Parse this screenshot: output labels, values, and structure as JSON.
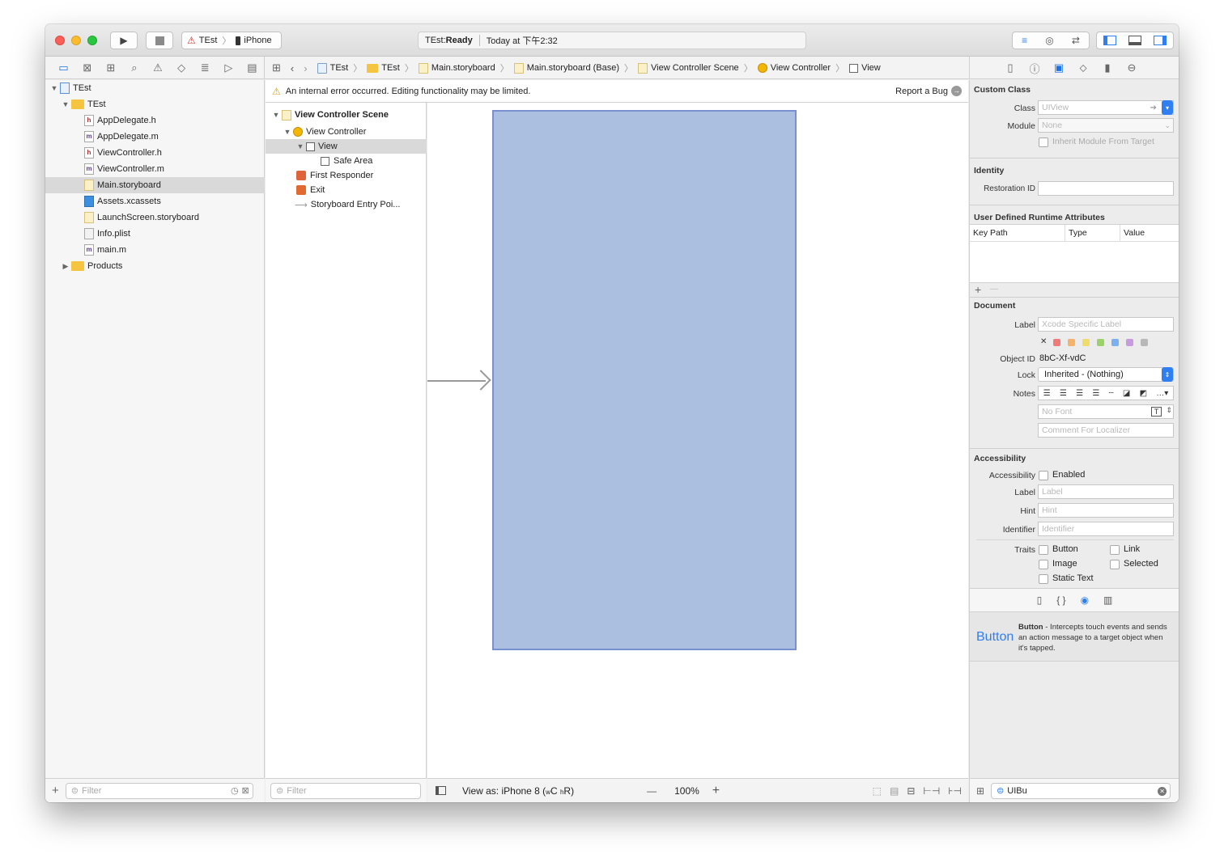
{
  "titlebar": {
    "scheme": "TEst",
    "device": "iPhone",
    "status_project": "TEst: ",
    "status_state": "Ready",
    "status_time": "Today at 下午2:32"
  },
  "jumpbar": {
    "crumbs": [
      "TEst",
      "TEst",
      "Main.storyboard",
      "Main.storyboard (Base)",
      "View Controller Scene",
      "View Controller",
      "View"
    ]
  },
  "warning": {
    "message": "An internal error occurred. Editing functionality may be limited.",
    "report": "Report a Bug"
  },
  "navigator": {
    "project": "TEst",
    "group": "TEst",
    "files": [
      "AppDelegate.h",
      "AppDelegate.m",
      "ViewController.h",
      "ViewController.m",
      "Main.storyboard",
      "Assets.xcassets",
      "LaunchScreen.storyboard",
      "Info.plist",
      "main.m"
    ],
    "products": "Products",
    "filter_placeholder": "Filter"
  },
  "outline": {
    "scene": "View Controller Scene",
    "items": [
      "View Controller",
      "View",
      "Safe Area",
      "First Responder",
      "Exit",
      "Storyboard Entry Poi..."
    ],
    "filter_placeholder": "Filter"
  },
  "canvas": {
    "view_as": "View as: iPhone 8 (",
    "size_class_w": "w",
    "size_class_c": "C",
    "size_class_h": "h",
    "size_class_r": "R)",
    "zoom_minus": "—",
    "zoom": "100%",
    "zoom_plus": "+"
  },
  "inspector": {
    "custom_class": {
      "title": "Custom Class",
      "class_label": "Class",
      "class_placeholder": "UIView",
      "module_label": "Module",
      "module_placeholder": "None",
      "inherit": "Inherit Module From Target"
    },
    "identity": {
      "title": "Identity",
      "restoration_label": "Restoration ID"
    },
    "runtime": {
      "title": "User Defined Runtime Attributes",
      "columns": [
        "Key Path",
        "Type",
        "Value"
      ],
      "add": "+",
      "remove": "—"
    },
    "document": {
      "title": "Document",
      "label_label": "Label",
      "label_placeholder": "Xcode Specific Label",
      "clear": "✕",
      "object_id_label": "Object ID",
      "object_id": "8bC-Xf-vdC",
      "lock_label": "Lock",
      "lock_value": "Inherited - (Nothing)",
      "notes_label": "Notes",
      "font_placeholder": "No Font",
      "comment_placeholder": "Comment For Localizer",
      "swatches": [
        "#f07a7a",
        "#f5b26b",
        "#f0dc6a",
        "#9bd36a",
        "#7ab0f0",
        "#c89be0",
        "#b8b8b8"
      ]
    },
    "accessibility": {
      "title": "Accessibility",
      "acc_label": "Accessibility",
      "enabled": "Enabled",
      "label_label": "Label",
      "label_placeholder": "Label",
      "hint_label": "Hint",
      "hint_placeholder": "Hint",
      "identifier_label": "Identifier",
      "identifier_placeholder": "Identifier",
      "traits_label": "Traits",
      "traits": [
        "Button",
        "Link",
        "Image",
        "Selected",
        "Static Text"
      ]
    },
    "library": {
      "icon_label": "Button",
      "name": "Button",
      "description": " - Intercepts touch events and sends an action message to a target object when it's tapped.",
      "search": "UIBu"
    }
  },
  "colors": {
    "accent": "#2f7ff2",
    "scene_fill": "#abc0e1",
    "selection": "#d9d9d9"
  }
}
